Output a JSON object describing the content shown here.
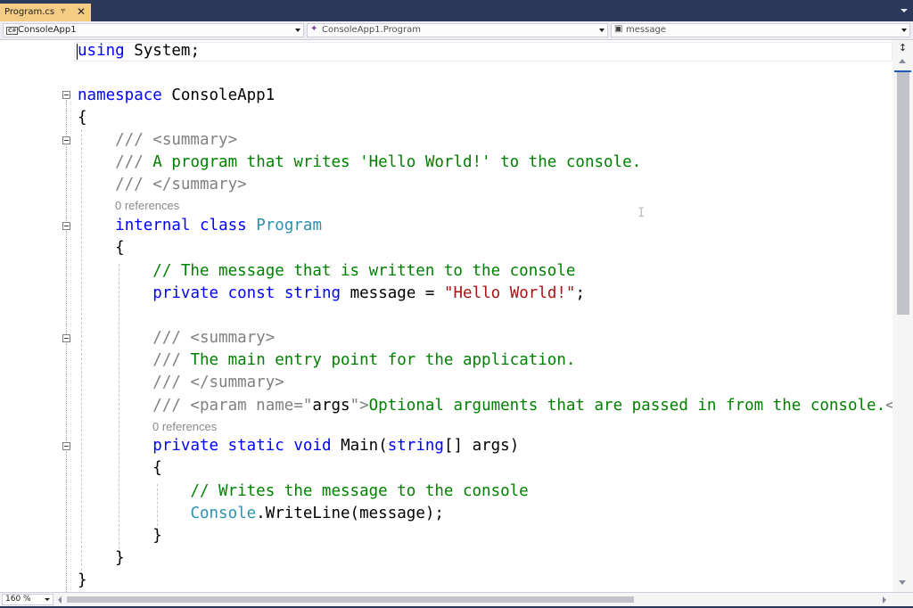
{
  "tab": {
    "title": "Program.cs",
    "pin_glyph": "⫧",
    "close_glyph": "✕"
  },
  "navbar": {
    "project_badge": "C#",
    "project": "ConsoleApp1",
    "class_glyph": "✦",
    "class": "ConsoleApp1.Program",
    "member_glyph": "▣",
    "member": "message"
  },
  "editor": {
    "zoom": "160 %",
    "code_lens": [
      "0 references",
      "0 references"
    ],
    "lines": [
      [
        {
          "t": "using",
          "c": "kw"
        },
        {
          "t": " System;",
          "c": "pl"
        }
      ],
      [
        {
          "t": "namespace",
          "c": "kw"
        },
        {
          "t": " ConsoleApp1",
          "c": "pl"
        }
      ],
      [
        {
          "t": "{",
          "c": "pl"
        }
      ],
      [
        {
          "t": "    /// <summary>",
          "c": "xd"
        }
      ],
      [
        {
          "t": "    ///",
          "c": "xd"
        },
        {
          "t": " A program that writes 'Hello World!' to the console.",
          "c": "cm"
        }
      ],
      [
        {
          "t": "    /// </summary>",
          "c": "xd"
        }
      ],
      [
        {
          "t": "    ",
          "c": "pl"
        },
        {
          "t": "internal",
          "c": "kw"
        },
        {
          "t": " ",
          "c": "pl"
        },
        {
          "t": "class",
          "c": "kw"
        },
        {
          "t": " ",
          "c": "pl"
        },
        {
          "t": "Program",
          "c": "ty"
        }
      ],
      [
        {
          "t": "    {",
          "c": "pl"
        }
      ],
      [
        {
          "t": "        // The message that is written to the console",
          "c": "cm"
        }
      ],
      [
        {
          "t": "        ",
          "c": "pl"
        },
        {
          "t": "private",
          "c": "kw"
        },
        {
          "t": " ",
          "c": "pl"
        },
        {
          "t": "const",
          "c": "kw"
        },
        {
          "t": " ",
          "c": "pl"
        },
        {
          "t": "string",
          "c": "kw"
        },
        {
          "t": " message = ",
          "c": "pl"
        },
        {
          "t": "\"Hello World!\"",
          "c": "st"
        },
        {
          "t": ";",
          "c": "pl"
        }
      ],
      [
        {
          "t": "        /// <summary>",
          "c": "xd"
        }
      ],
      [
        {
          "t": "        ///",
          "c": "xd"
        },
        {
          "t": " The main entry point for the application.",
          "c": "cm"
        }
      ],
      [
        {
          "t": "        /// </summary>",
          "c": "xd"
        }
      ],
      [
        {
          "t": "        /// <param name=\"",
          "c": "xd"
        },
        {
          "t": "args",
          "c": "pl"
        },
        {
          "t": "\">",
          "c": "xd"
        },
        {
          "t": "Optional arguments that are passed in from the console.",
          "c": "cm"
        },
        {
          "t": "</param>",
          "c": "xd"
        }
      ],
      [
        {
          "t": "        ",
          "c": "pl"
        },
        {
          "t": "private",
          "c": "kw"
        },
        {
          "t": " ",
          "c": "pl"
        },
        {
          "t": "static",
          "c": "kw"
        },
        {
          "t": " ",
          "c": "pl"
        },
        {
          "t": "void",
          "c": "kw"
        },
        {
          "t": " Main(",
          "c": "pl"
        },
        {
          "t": "string",
          "c": "kw"
        },
        {
          "t": "[] args)",
          "c": "pl"
        }
      ],
      [
        {
          "t": "        {",
          "c": "pl"
        }
      ],
      [
        {
          "t": "            // Writes the message to the console",
          "c": "cm"
        }
      ],
      [
        {
          "t": "            ",
          "c": "pl"
        },
        {
          "t": "Console",
          "c": "ty"
        },
        {
          "t": ".WriteLine(message);",
          "c": "pl"
        }
      ],
      [
        {
          "t": "        }",
          "c": "pl"
        }
      ],
      [
        {
          "t": "    }",
          "c": "pl"
        }
      ],
      [
        {
          "t": "}",
          "c": "pl"
        }
      ]
    ]
  },
  "scrollbar": {
    "split_glyph": "↕"
  }
}
